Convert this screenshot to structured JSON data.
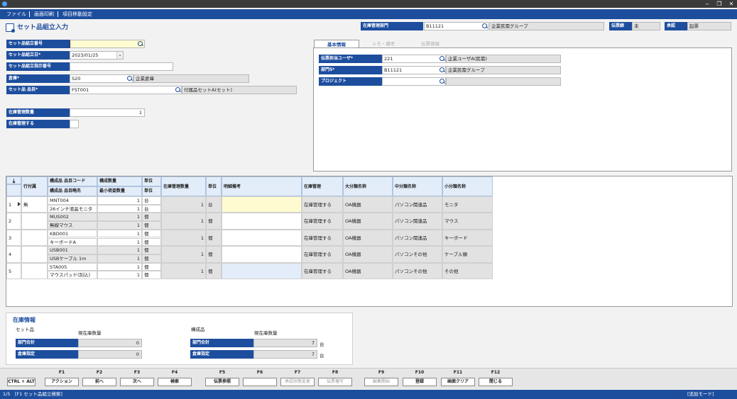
{
  "window": {
    "minimize": "‒",
    "restore": "❐",
    "close": "✕"
  },
  "menu": {
    "items": [
      "ファイル",
      "画面印刷",
      "項目移動設定"
    ]
  },
  "page": {
    "title": "セット品組立入力"
  },
  "header": {
    "dept_label": "在庫管理部門",
    "dept_code": "B11121",
    "dept_name": "企業民需グループ",
    "slip_label": "伝票締",
    "slip_value": "未",
    "approval_label": "承認",
    "approval_value": "起票"
  },
  "form": {
    "set_no_label": "セット品組立番号",
    "set_no_value": "",
    "date_label": "セット品組立日*",
    "date_value": "2023/01/25",
    "instr_label": "セット品組立指示番号",
    "instr_value": "",
    "warehouse_label": "倉庫*",
    "warehouse_code": "S20",
    "warehouse_name": "企業倉庫",
    "item_label": "セット品 品目*",
    "item_code": "FST001",
    "item_name": "付属品セットA(セット)",
    "qty_label": "在庫管理数量",
    "qty_value": "1",
    "manage_label": "在庫管理する"
  },
  "tabs": {
    "basic": "基本情報",
    "memo": "メモ・備考",
    "slip": "伝票情報"
  },
  "basic": {
    "user_label": "伝票担当ユーザ*",
    "user_code": "221",
    "user_name": "企業ユーザA(民需)",
    "dept_label": "部門5*",
    "dept_code": "B11121",
    "dept_name": "企業民需グループ",
    "project_label": "プロジェクト",
    "project_code": "",
    "project_name": ""
  },
  "grid": {
    "h_rowadd": "行付属",
    "h_code": "構成品 品目コード",
    "h_name": "構成品 品目略名",
    "h_qty": "構成数量",
    "h_minqty": "最小荷姿数量",
    "h_unit": "単位",
    "h_unit2": "単位",
    "h_stockqty": "在庫管理数量",
    "h_stockunit": "単位",
    "h_note": "明細備考",
    "h_manage": "在庫管理",
    "h_cat1": "大分類名称",
    "h_cat2": "中分類名称",
    "h_cat3": "小分類名称",
    "rows": [
      {
        "no": "1",
        "flag": "無",
        "code": "MNT004",
        "name": "26インチ液晶モニタ",
        "qty": "1",
        "unit": "台",
        "minqty": "1",
        "unit2": "台",
        "stockqty": "1",
        "stockunit": "台",
        "note": "",
        "manage": "在庫管理する",
        "cat1": "OA機器",
        "cat2": "パソコン関連品",
        "cat3": "モニタ"
      },
      {
        "no": "2",
        "flag": "",
        "code": "MUS002",
        "name": "無線マウス",
        "qty": "1",
        "unit": "個",
        "minqty": "1",
        "unit2": "個",
        "stockqty": "1",
        "stockunit": "個",
        "note": "",
        "manage": "在庫管理する",
        "cat1": "OA機器",
        "cat2": "パソコン関連品",
        "cat3": "マウス"
      },
      {
        "no": "3",
        "flag": "",
        "code": "KBD001",
        "name": "キーボードA",
        "qty": "1",
        "unit": "個",
        "minqty": "1",
        "unit2": "個",
        "stockqty": "1",
        "stockunit": "個",
        "note": "",
        "manage": "在庫管理する",
        "cat1": "OA機器",
        "cat2": "パソコン関連品",
        "cat3": "キーボード"
      },
      {
        "no": "4",
        "flag": "",
        "code": "USB001",
        "name": "USBケーブル 1m",
        "qty": "1",
        "unit": "個",
        "minqty": "1",
        "unit2": "個",
        "stockqty": "1",
        "stockunit": "個",
        "note": "",
        "manage": "在庫管理する",
        "cat1": "OA機器",
        "cat2": "パソコンその他",
        "cat3": "ケーブル類"
      },
      {
        "no": "5",
        "flag": "",
        "code": "STA005",
        "name": "マウスパッド(別込)",
        "qty": "1",
        "unit": "個",
        "minqty": "1",
        "unit2": "個",
        "stockqty": "1",
        "stockunit": "個",
        "note": "",
        "manage": "在庫管理する",
        "cat1": "OA機器",
        "cat2": "パソコンその他",
        "cat3": "その他"
      }
    ]
  },
  "stock": {
    "title": "在庫情報",
    "set_label": "セット品",
    "set_qty_label": "現在庫数量",
    "set_dept_label": "部門合計",
    "set_dept_value": "0",
    "set_wh_label": "倉庫指定",
    "set_wh_value": "0",
    "comp_label": "構成品",
    "comp_qty_label": "現在庫数量",
    "comp_dept_label": "部門合計",
    "comp_dept_value": "7",
    "comp_dept_unit": "台",
    "comp_wh_label": "倉庫指定",
    "comp_wh_value": "7",
    "comp_wh_unit": "台"
  },
  "fkeys": {
    "ctrl": "CTRL + ALT",
    "keys": [
      {
        "key": "F1",
        "label": "アクション"
      },
      {
        "key": "F2",
        "label": "前へ"
      },
      {
        "key": "F3",
        "label": "次へ"
      },
      {
        "key": "F4",
        "label": "検索"
      },
      {
        "key": "F5",
        "label": "伝票参照"
      },
      {
        "key": "F6",
        "label": ""
      },
      {
        "key": "F7",
        "label": "承認状態変更"
      },
      {
        "key": "F8",
        "label": "伝票複写"
      },
      {
        "key": "F9",
        "label": "編集開始"
      },
      {
        "key": "F10",
        "label": "登録"
      },
      {
        "key": "F11",
        "label": "画面クリア"
      },
      {
        "key": "F12",
        "label": "閉じる"
      }
    ]
  },
  "status": {
    "left": "1/5　[F1 セット品組立検索]",
    "right": "[追加モード]"
  }
}
